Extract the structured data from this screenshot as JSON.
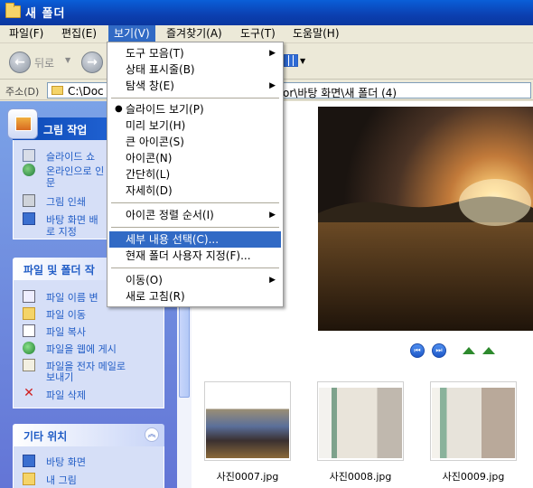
{
  "window": {
    "title": "새 폴더"
  },
  "menubar": [
    "파일(F)",
    "편집(E)",
    "보기(V)",
    "즐겨찾기(A)",
    "도구(T)",
    "도움말(H)"
  ],
  "toolbar": {
    "back_label": "뒤로"
  },
  "address": {
    "label": "주소(D)",
    "path_left": "C:\\Doc",
    "path_right": "or\\바탕 화면\\새 폴더 (4)"
  },
  "view_menu": {
    "items": [
      {
        "label": "도구 모음(T)",
        "submenu": true
      },
      {
        "label": "상태 표시줄(B)"
      },
      {
        "label": "탐색 창(E)",
        "submenu": true
      },
      {
        "label": "슬라이드 보기(P)",
        "checked": true
      },
      {
        "label": "미리 보기(H)"
      },
      {
        "label": "큰 아이콘(S)"
      },
      {
        "label": "아이콘(N)"
      },
      {
        "label": "간단히(L)"
      },
      {
        "label": "자세히(D)"
      },
      {
        "label": "아이콘 정렬 순서(I)",
        "submenu": true
      },
      {
        "label": "세부 내용 선택(C)...",
        "highlighted": true
      },
      {
        "label": "현재 폴더 사용자 지정(F)..."
      },
      {
        "label": "이동(O)",
        "submenu": true
      },
      {
        "label": "새로 고침(R)"
      }
    ]
  },
  "picture_tasks": {
    "title": "그림 작업",
    "items": [
      "슬라이드 쇼",
      "온라인으로 인",
      "문",
      "그림 인쇄",
      "바탕 화면 배",
      "로 지정"
    ]
  },
  "file_folder_tasks": {
    "title": "파일 및 폴더 작",
    "items": [
      "파일 이름 변",
      "파일 이동",
      "파일 복사",
      "파일을 웹에 게시",
      "파일을 전자 메일로",
      "보내기",
      "파일 삭제"
    ]
  },
  "other_places": {
    "title": "기타 위치",
    "items": [
      "바탕 화면",
      "내 그림"
    ]
  },
  "thumbnails": [
    "사진0007.jpg",
    "사진0008.jpg",
    "사진0009.jpg"
  ],
  "colors": {
    "title_bar": "#0b3fb0",
    "menu_highlight": "#316ac5",
    "task_pane": "#6375d6",
    "task_link": "#215dc6"
  }
}
